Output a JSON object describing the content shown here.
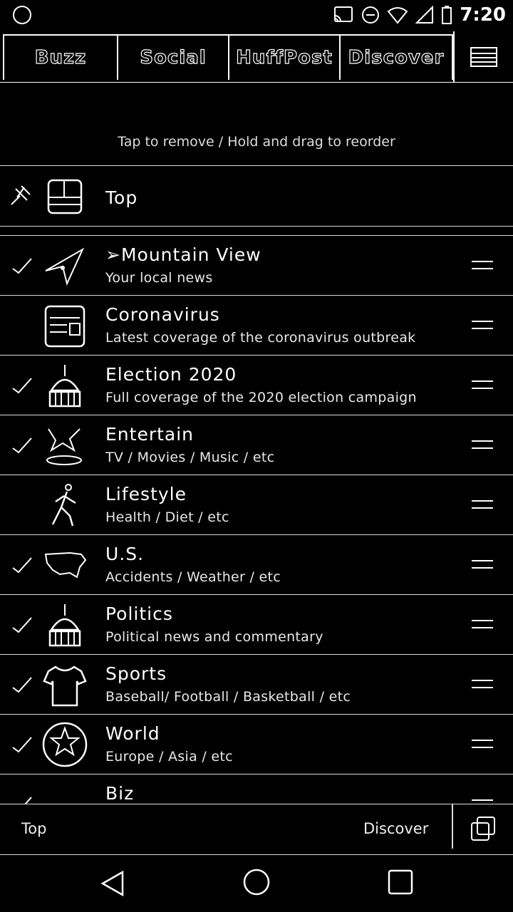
{
  "status_bar": {
    "time": "7:20",
    "icons": [
      "cast-icon",
      "do-not-disturb-icon",
      "wifi-icon",
      "signal-icon",
      "battery-icon"
    ]
  },
  "tabs": [
    {
      "label": "Buzz"
    },
    {
      "label": "Social"
    },
    {
      "label": "HuffPost"
    },
    {
      "label": "Discover"
    }
  ],
  "hint": "Tap to remove / Hold and drag to reorder",
  "pinned": {
    "title": "Top",
    "icon": "newspaper-icon"
  },
  "topics": [
    {
      "title": "➢Mountain View",
      "subtitle": "Your local news",
      "checked": true,
      "icon": "location-arrow-icon"
    },
    {
      "title": "Coronavirus",
      "subtitle": "Latest coverage of the coronavirus outbreak",
      "checked": false,
      "icon": "news-document-icon"
    },
    {
      "title": "Election 2020",
      "subtitle": "Full coverage of the 2020 election campaign",
      "checked": true,
      "icon": "capitol-building-icon"
    },
    {
      "title": "Entertain",
      "subtitle": "TV / Movies / Music / etc",
      "checked": true,
      "icon": "entertainment-icon"
    },
    {
      "title": "Lifestyle",
      "subtitle": "Health / Diet / etc",
      "checked": false,
      "icon": "runner-icon"
    },
    {
      "title": "U.S.",
      "subtitle": "Accidents / Weather / etc",
      "checked": true,
      "icon": "us-map-icon"
    },
    {
      "title": "Politics",
      "subtitle": "Political news and commentary",
      "checked": true,
      "icon": "capitol-building-icon"
    },
    {
      "title": "Sports",
      "subtitle": "Baseball/ Football / Basketball / etc",
      "checked": true,
      "icon": "sports-jersey-icon"
    },
    {
      "title": "World",
      "subtitle": "Europe / Asia / etc",
      "checked": true,
      "icon": "globe-icon"
    },
    {
      "title": "Biz",
      "subtitle": "",
      "checked": true,
      "icon": "business-icon"
    }
  ],
  "bottom_bar": {
    "left_label": "Top",
    "right_label": "Discover"
  }
}
